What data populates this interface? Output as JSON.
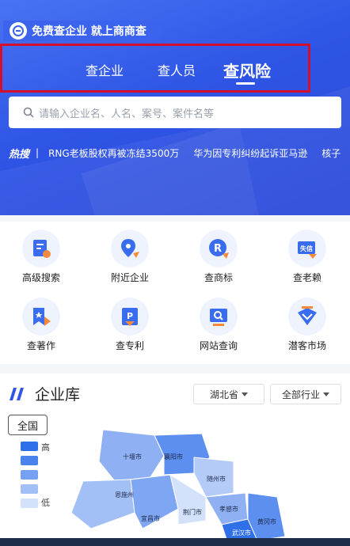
{
  "banner": {
    "pill_text": "免费查企业 就上商商查"
  },
  "tabs": [
    {
      "label": "查企业",
      "active": false
    },
    {
      "label": "查人员",
      "active": false
    },
    {
      "label": "查风险",
      "active": true
    }
  ],
  "search": {
    "placeholder": "请输入企业名、人名、案号、案件名等"
  },
  "hot": {
    "label": "热搜",
    "items": [
      "RNG老板股权再被冻结3500万",
      "华为因专利纠纷起诉亚马逊",
      "核子"
    ]
  },
  "features": [
    {
      "label": "高级搜索",
      "icon": "advanced-search-icon"
    },
    {
      "label": "附近企业",
      "icon": "location-pin-icon"
    },
    {
      "label": "查商标",
      "icon": "trademark-icon",
      "glyph": "R"
    },
    {
      "label": "查老赖",
      "icon": "dishonest-icon",
      "glyph": "失信"
    },
    {
      "label": "查著作",
      "icon": "copyright-work-icon"
    },
    {
      "label": "查专利",
      "icon": "patent-icon",
      "glyph": "P"
    },
    {
      "label": "网站查询",
      "icon": "website-search-icon"
    },
    {
      "label": "潜客市场",
      "icon": "potential-customer-icon"
    }
  ],
  "library": {
    "title": "企业库",
    "province_dropdown": "湖北省",
    "industry_dropdown": "全部行业",
    "scope_button": "全国",
    "legend": {
      "high": "高",
      "low": "低"
    },
    "legend_colors": [
      "#2f6fe8",
      "#4b83ee",
      "#76a1f3",
      "#a3c0f6",
      "#d3e1fb"
    ],
    "map_labels": [
      "十堰市",
      "襄阳市",
      "随州市",
      "恩施州",
      "宜昌市",
      "荆门市",
      "孝感市",
      "武汉市",
      "黄冈市"
    ]
  },
  "colors": {
    "accent": "#2f55e6",
    "highlight_border": "#d40f2d",
    "orange": "#f58a3c"
  }
}
